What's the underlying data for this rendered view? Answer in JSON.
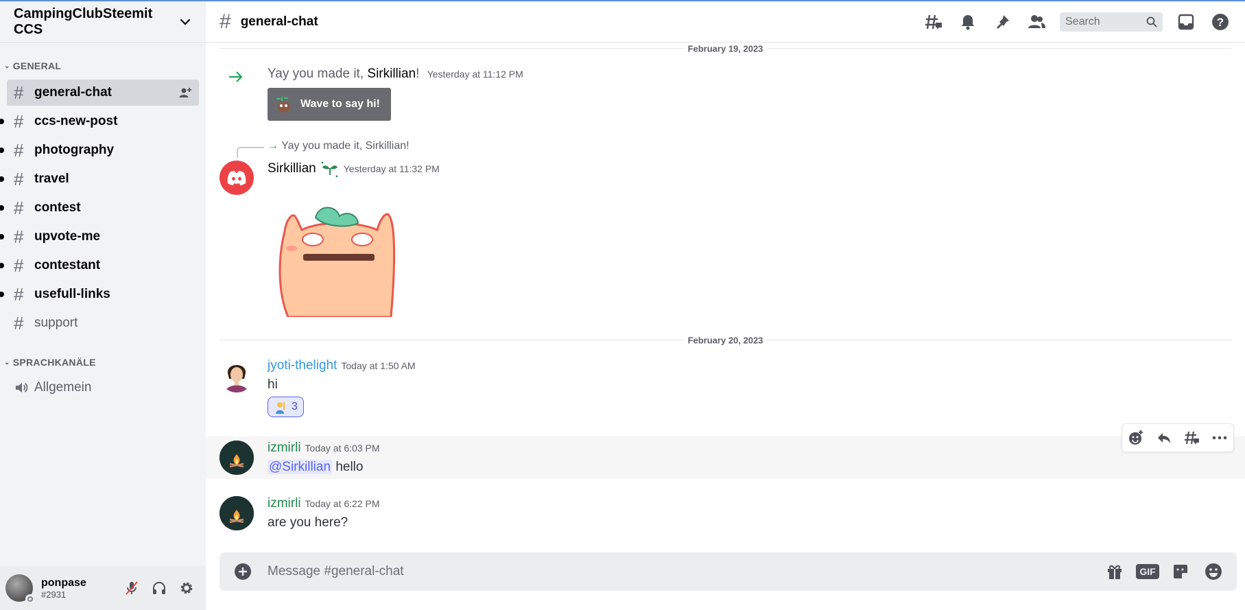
{
  "server": {
    "name": "CampingClubSteemit CCS"
  },
  "sidebar": {
    "categories": [
      {
        "label": "GENERAL",
        "channels": [
          {
            "name": "general-chat",
            "state": "selected"
          },
          {
            "name": "ccs-new-post",
            "state": "unread"
          },
          {
            "name": "photography",
            "state": "unread"
          },
          {
            "name": "travel",
            "state": "unread"
          },
          {
            "name": "contest",
            "state": "unread"
          },
          {
            "name": "upvote-me",
            "state": "unread"
          },
          {
            "name": "contestant",
            "state": "unread"
          },
          {
            "name": "usefull-links",
            "state": "unread"
          },
          {
            "name": "support",
            "state": "read"
          }
        ]
      },
      {
        "label": "SPRACHKANÄLE",
        "channels": [
          {
            "name": "Allgemein",
            "type": "voice"
          }
        ]
      }
    ],
    "user": {
      "name": "ponpase",
      "tag": "#2931"
    }
  },
  "header": {
    "channel": "general-chat",
    "search_placeholder": "Search"
  },
  "messages": {
    "date1": "February 19, 2023",
    "join": {
      "prefix": "Yay you made it, ",
      "name": "Sirkillian",
      "suffix": "!",
      "timestamp": "Yesterday at 11:12 PM",
      "button": "Wave to say hi!"
    },
    "reply": {
      "reply_preview": "Yay you made it, Sirkillian!",
      "author": "Sirkillian",
      "timestamp": "Yesterday at 11:32 PM"
    },
    "date2": "February 20, 2023",
    "msg1": {
      "author": "jyoti-thelight",
      "timestamp": "Today at 1:50 AM",
      "text": "hi",
      "reaction_count": "3"
    },
    "msg2": {
      "author": "izmirli",
      "timestamp": "Today at 6:03 PM",
      "mention": "@Sirkillian",
      "text": "hello"
    },
    "msg3": {
      "author": "izmirli",
      "timestamp": "Today at 6:22 PM",
      "text": "are you here?"
    }
  },
  "composer": {
    "placeholder": "Message #general-chat",
    "gif_label": "GIF"
  },
  "colors": {
    "accent": "#5865f2",
    "green_author": "#1f8b4c",
    "blue_author": "#3498db",
    "sidebar_bg": "#f2f3f5"
  },
  "icons": [
    "chevron-down-icon",
    "hash-icon",
    "add-member-icon",
    "speaker-icon",
    "threads-icon",
    "bell-icon",
    "pin-icon",
    "members-icon",
    "search-icon",
    "inbox-icon",
    "help-icon",
    "join-arrow-icon",
    "discord-icon",
    "add-reaction-icon",
    "reply-icon",
    "thread-icon",
    "more-icon",
    "plus-circle-icon",
    "gift-icon",
    "sticker-icon",
    "emoji-icon",
    "mic-muted-icon",
    "headphones-icon",
    "gear-icon"
  ]
}
